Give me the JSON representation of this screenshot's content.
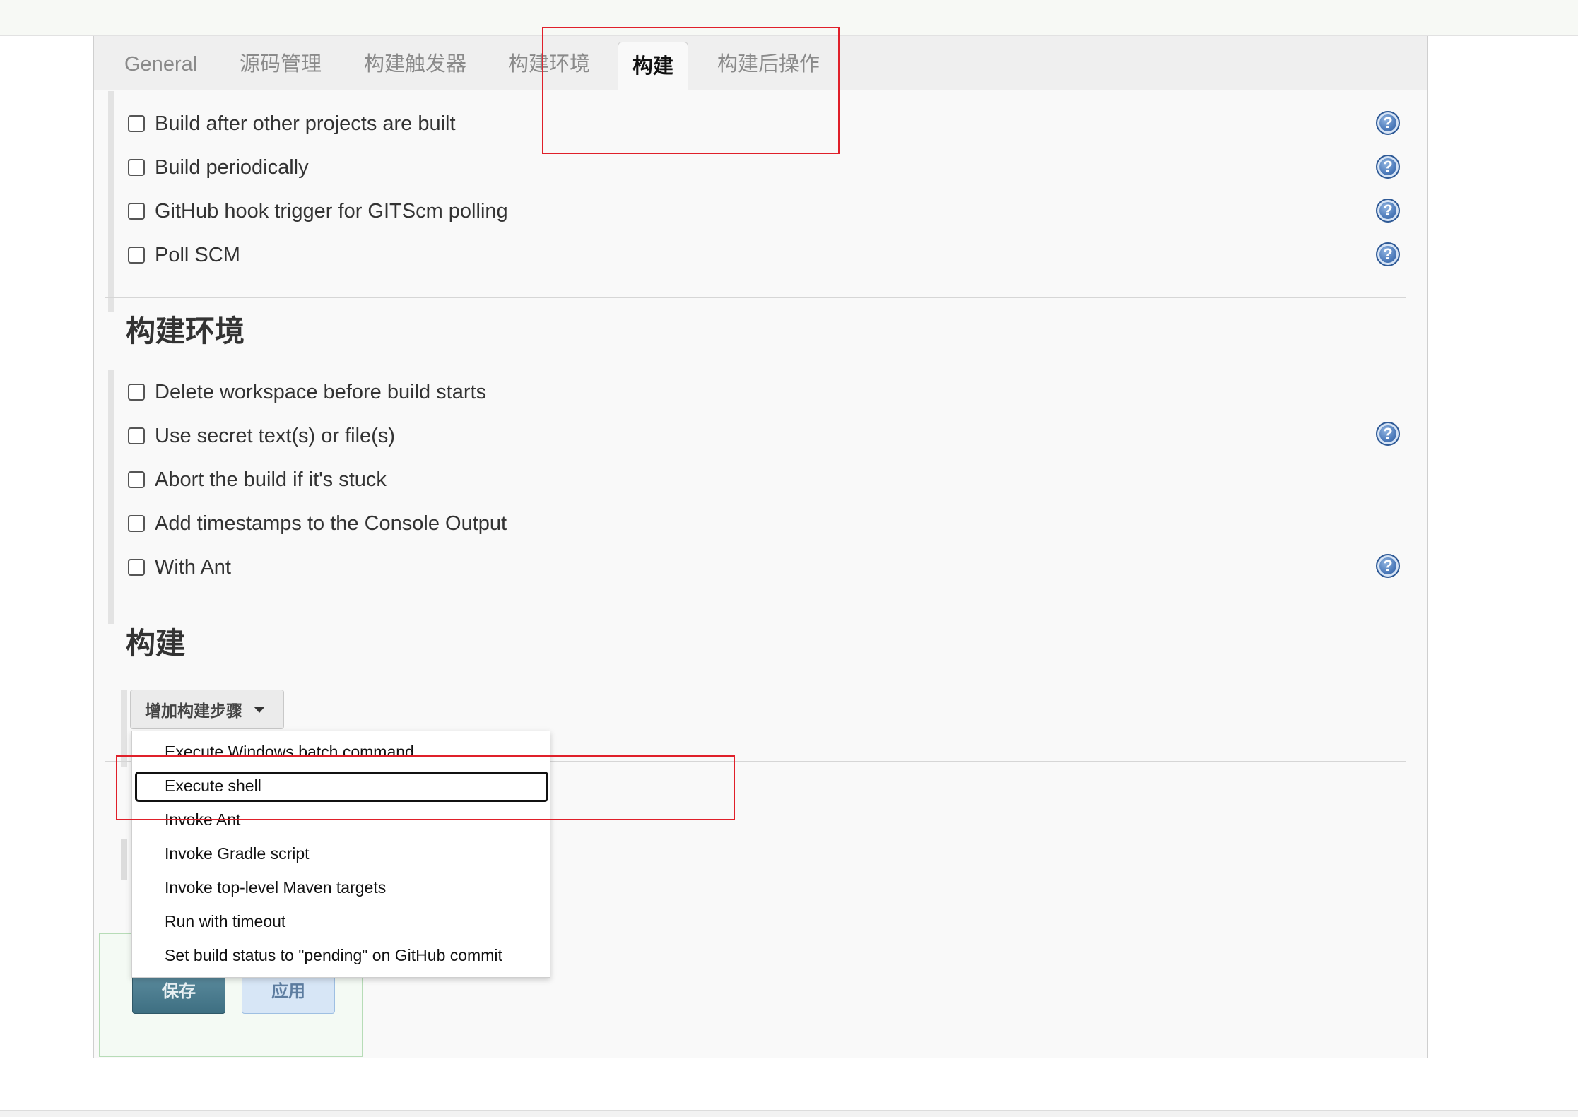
{
  "tabs": [
    {
      "label": "General"
    },
    {
      "label": "源码管理"
    },
    {
      "label": "构建触发器"
    },
    {
      "label": "构建环境"
    },
    {
      "label": "构建",
      "active": true
    },
    {
      "label": "构建后操作"
    }
  ],
  "triggers": [
    {
      "label": "Build after other projects are built",
      "checked": false,
      "help": true
    },
    {
      "label": "Build periodically",
      "checked": false,
      "help": true
    },
    {
      "label": "GitHub hook trigger for GITScm polling",
      "checked": false,
      "help": true
    },
    {
      "label": "Poll SCM",
      "checked": false,
      "help": true
    }
  ],
  "build_env": {
    "title": "构建环境",
    "options": [
      {
        "label": "Delete workspace before build starts",
        "checked": false,
        "help": false
      },
      {
        "label": "Use secret text(s) or file(s)",
        "checked": false,
        "help": true
      },
      {
        "label": "Abort the build if it's stuck",
        "checked": false,
        "help": false
      },
      {
        "label": "Add timestamps to the Console Output",
        "checked": false,
        "help": false
      },
      {
        "label": "With Ant",
        "checked": false,
        "help": true
      }
    ]
  },
  "build": {
    "title": "构建",
    "add_step_label": "增加构建步骤",
    "menu_items": [
      "Execute Windows batch command",
      "Execute shell",
      "Invoke Ant",
      "Invoke Gradle script",
      "Invoke top-level Maven targets",
      "Run with timeout",
      "Set build status to \"pending\" on GitHub commit"
    ],
    "focused_item": "Execute shell"
  },
  "actions": {
    "save_label": "保存",
    "apply_label": "应用"
  },
  "help_icon_glyph": "?",
  "colors": {
    "highlight_box": "#e0202a",
    "save_button": "#4a7a8c",
    "apply_button": "#d7e6f6"
  }
}
